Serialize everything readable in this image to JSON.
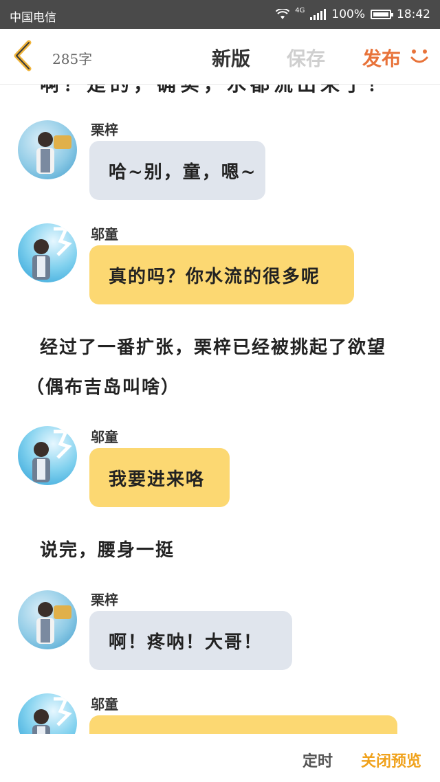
{
  "statusbar": {
    "carrier": "中国电信",
    "network": "4G",
    "battery": "100%",
    "time": "18:42"
  },
  "header": {
    "word_count": "285字",
    "new_version": "新版",
    "save": "保存",
    "publish": "发布"
  },
  "content": {
    "cut_line": "啊？是的，确实，水都流出来了！",
    "messages": [
      {
        "name": "栗梓",
        "text": "哈~别，童，嗯~"
      },
      {
        "name": "邬童",
        "text": "真的吗？你水流的很多呢"
      },
      {
        "name": "邬童",
        "text": "我要进来咯"
      },
      {
        "name": "栗梓",
        "text": "啊！疼呐！大哥！"
      },
      {
        "name": "邬童",
        "text": ""
      }
    ],
    "narration": [
      "经过了一番扩张，栗梓已经被挑起了欲望",
      "（偶布吉岛叫啥）",
      "说完，腰身一挺"
    ]
  },
  "footer": {
    "timer": "定时",
    "close_preview": "关闭预览"
  },
  "colors": {
    "accent": "#e8733a",
    "gray_bubble": "#e0e5ed",
    "yellow_bubble": "#fcd872",
    "close_preview": "#f0a21c"
  }
}
